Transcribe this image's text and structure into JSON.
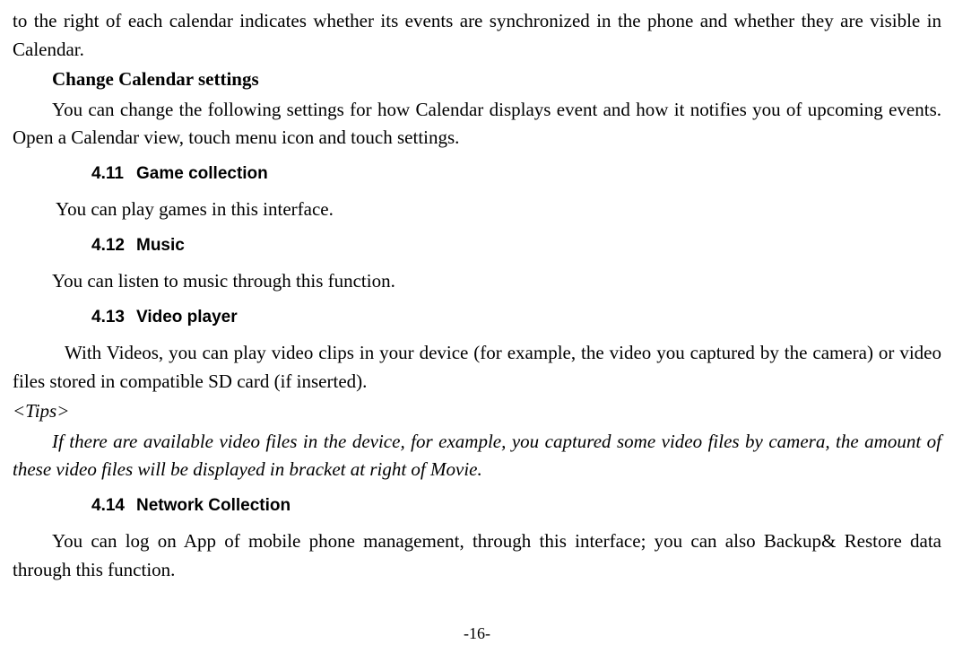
{
  "intro_continuation": "to the right of each calendar indicates whether its events are synchronized in the phone and whether they are visible in Calendar.",
  "change_settings_heading": "Change Calendar settings",
  "change_settings_body": "You can change the following settings for how Calendar displays event and how it notifies you of upcoming events. Open a Calendar view, touch menu icon and touch settings.",
  "sections": {
    "s411": {
      "num": "4.11",
      "title": "Game collection",
      "body": "You can play games in this interface."
    },
    "s412": {
      "num": "4.12",
      "title": "Music",
      "body": "You can listen to music through this function."
    },
    "s413": {
      "num": "4.13",
      "title": "Video player",
      "body": "With Videos, you can play video clips in your device (for example, the video you captured by the camera) or video files stored in compatible SD card (if inserted)."
    },
    "s414": {
      "num": "4.14",
      "title": "Network Collection",
      "body": "You can log on App of mobile phone management, through this interface; you can also Backup& Restore data through this function."
    }
  },
  "tips_label": "<Tips>",
  "tips_body": "If there are available video files in the device, for example, you captured some video files by camera, the amount of these video files will be displayed in bracket at right of Movie.",
  "page_number": "-16-"
}
